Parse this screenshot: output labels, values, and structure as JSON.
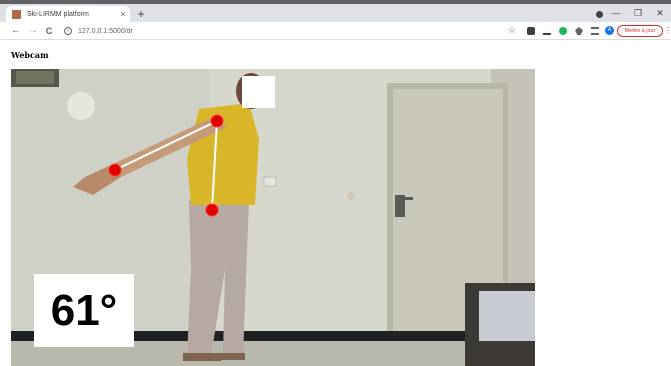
{
  "browser": {
    "tab_title": "Ski-LIRMM platform",
    "tab_close": "×",
    "new_tab": "+",
    "url": "127.0.0.1:5000/dr",
    "update_button": "Mettre à jour",
    "menu": "⋮",
    "minimize": "—",
    "restore": "❐",
    "close": "✕",
    "back": "←",
    "forward": "→",
    "reload": "C",
    "profile_initial": "A"
  },
  "page": {
    "heading": "Webcam"
  },
  "webcam": {
    "angle_display": "61°"
  },
  "colors": {
    "joint": "#e00000",
    "skeleton_line": "#ffffff",
    "accent_red": "#d93025"
  }
}
